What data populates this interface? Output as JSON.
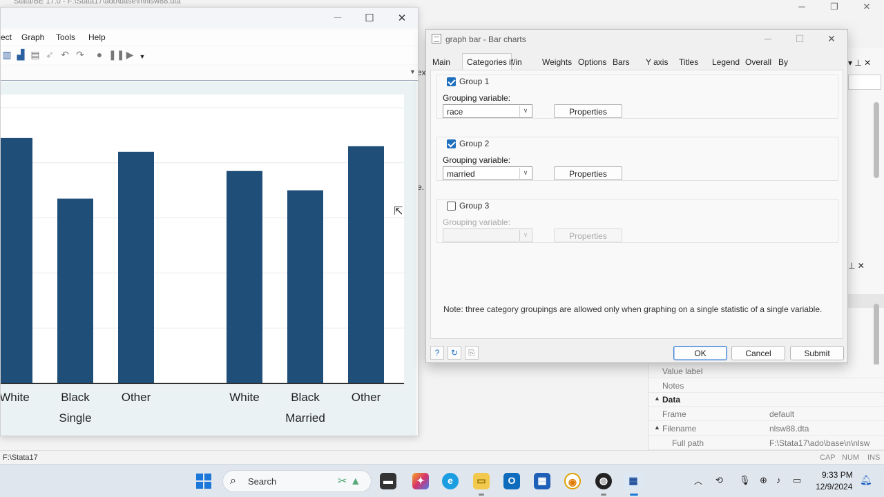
{
  "background_window": {
    "title": "Stata/BE 17.0 - F:\\Stata17\\ado\\base\\n\\nlsw88.dta",
    "side_text_1": "ex",
    "side_text_2": "e."
  },
  "properties_panel": {
    "rows": [
      {
        "key": "Value label",
        "value": ""
      },
      {
        "key": "Notes",
        "value": ""
      },
      {
        "key": "Data",
        "value": "",
        "header": true
      },
      {
        "key": "Frame",
        "value": "default"
      },
      {
        "key": "Filename",
        "value": "nlsw88.dta"
      },
      {
        "key": "Full path",
        "value": "F:\\Stata17\\ado\\base\\n\\nlsw"
      }
    ]
  },
  "status_bar": {
    "path": "F:\\Stata17",
    "indicators": [
      "CAP",
      "NUM",
      "INS"
    ]
  },
  "graph_window": {
    "menu": [
      "ect",
      "Graph",
      "Tools",
      "Help"
    ],
    "toolbar_icons": [
      "graph-icon",
      "document-icon",
      "pointer-icon",
      "undo-icon",
      "redo-icon",
      "record-icon",
      "pause-icon",
      "play-icon"
    ]
  },
  "chart_data": {
    "type": "bar",
    "groups": [
      "Single",
      "Married"
    ],
    "categories": [
      "White",
      "Black",
      "Other"
    ],
    "values": [
      [
        89,
        67,
        84
      ],
      [
        77,
        70,
        86
      ]
    ],
    "ylim": [
      0,
      100
    ],
    "bar_color": "#1f4e79",
    "grid": true
  },
  "dialog": {
    "title": "graph bar - Bar charts",
    "tabs": [
      "Main",
      "Categories",
      "if/in",
      "Weights",
      "Options",
      "Bars",
      "Y axis",
      "Titles",
      "Legend",
      "Overall",
      "By"
    ],
    "active_tab": "Categories",
    "groups": [
      {
        "label": "Group 1",
        "checked": true,
        "gv_label": "Grouping variable:",
        "variable": "race",
        "properties": "Properties"
      },
      {
        "label": "Group 2",
        "checked": true,
        "gv_label": "Grouping variable:",
        "variable": "married",
        "properties": "Properties"
      },
      {
        "label": "Group 3",
        "checked": false,
        "gv_label": "Grouping variable:",
        "variable": "",
        "properties": "Properties"
      }
    ],
    "note": "Note: three category groupings are allowed only when graphing on a single statistic of a single variable.",
    "buttons": {
      "ok": "OK",
      "cancel": "Cancel",
      "submit": "Submit"
    }
  },
  "taskbar": {
    "search_placeholder": "Search",
    "time": "9:33 PM",
    "date": "12/9/2024",
    "colors": {
      "accent": "#1b78d8"
    }
  }
}
